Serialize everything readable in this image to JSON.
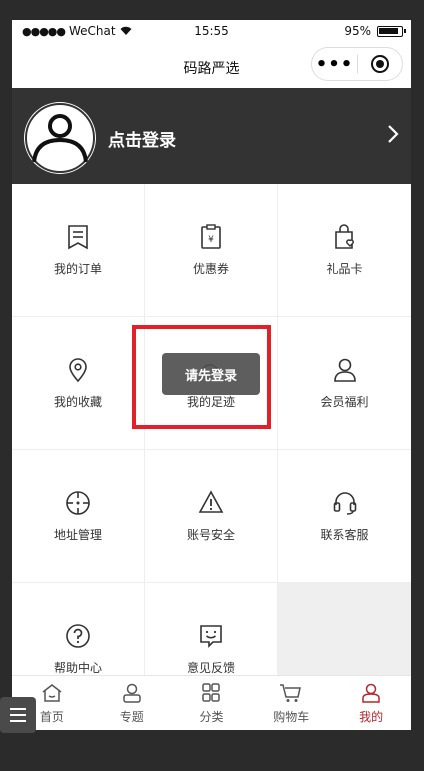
{
  "status_bar": {
    "carrier": "WeChat",
    "signal_dots": "●●●●●",
    "time": "15:55",
    "battery": "95%"
  },
  "nav": {
    "title": "码路严选",
    "more_glyph": "•••"
  },
  "profile": {
    "login_label": "点击登录"
  },
  "menu": {
    "orders": "我的订单",
    "coupons": "优惠券",
    "gift_card": "礼品卡",
    "favorites": "我的收藏",
    "footprints": "我的足迹",
    "member_benefits": "会员福利",
    "address": "地址管理",
    "account_security": "账号安全",
    "customer_service": "联系客服",
    "help_center": "帮助中心",
    "feedback": "意见反馈"
  },
  "toast": {
    "message": "请先登录"
  },
  "tabbar": {
    "home": "首页",
    "topics": "专题",
    "category": "分类",
    "cart": "购物车",
    "mine": "我的"
  },
  "colors": {
    "profile_bg": "#333333",
    "accent": "#b5262d",
    "highlight": "#e3202a"
  }
}
